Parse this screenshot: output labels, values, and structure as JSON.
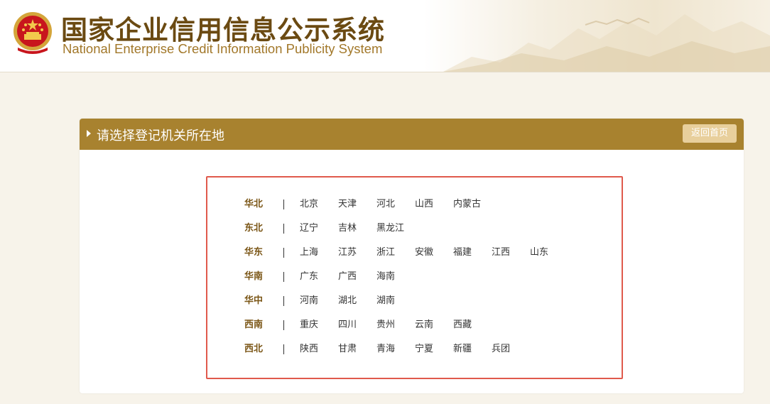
{
  "header": {
    "title_cn": "国家企业信用信息公示系统",
    "title_en": "National Enterprise Credit Information Publicity System"
  },
  "panel": {
    "title": "请选择登记机关所在地",
    "home_label": "返回首页"
  },
  "regions": [
    {
      "name": "华北",
      "provinces": [
        "北京",
        "天津",
        "河北",
        "山西",
        "内蒙古"
      ]
    },
    {
      "name": "东北",
      "provinces": [
        "辽宁",
        "吉林",
        "黑龙江"
      ]
    },
    {
      "name": "华东",
      "provinces": [
        "上海",
        "江苏",
        "浙江",
        "安徽",
        "福建",
        "江西",
        "山东"
      ]
    },
    {
      "name": "华南",
      "provinces": [
        "广东",
        "广西",
        "海南"
      ]
    },
    {
      "name": "华中",
      "provinces": [
        "河南",
        "湖北",
        "湖南"
      ]
    },
    {
      "name": "西南",
      "provinces": [
        "重庆",
        "四川",
        "贵州",
        "云南",
        "西藏"
      ]
    },
    {
      "name": "西北",
      "provinces": [
        "陕西",
        "甘肃",
        "青海",
        "宁夏",
        "新疆",
        "兵团"
      ]
    }
  ],
  "colors": {
    "brand_gold": "#a8822f",
    "title_brown": "#6b4a12",
    "highlight_red": "#e05a4c"
  }
}
